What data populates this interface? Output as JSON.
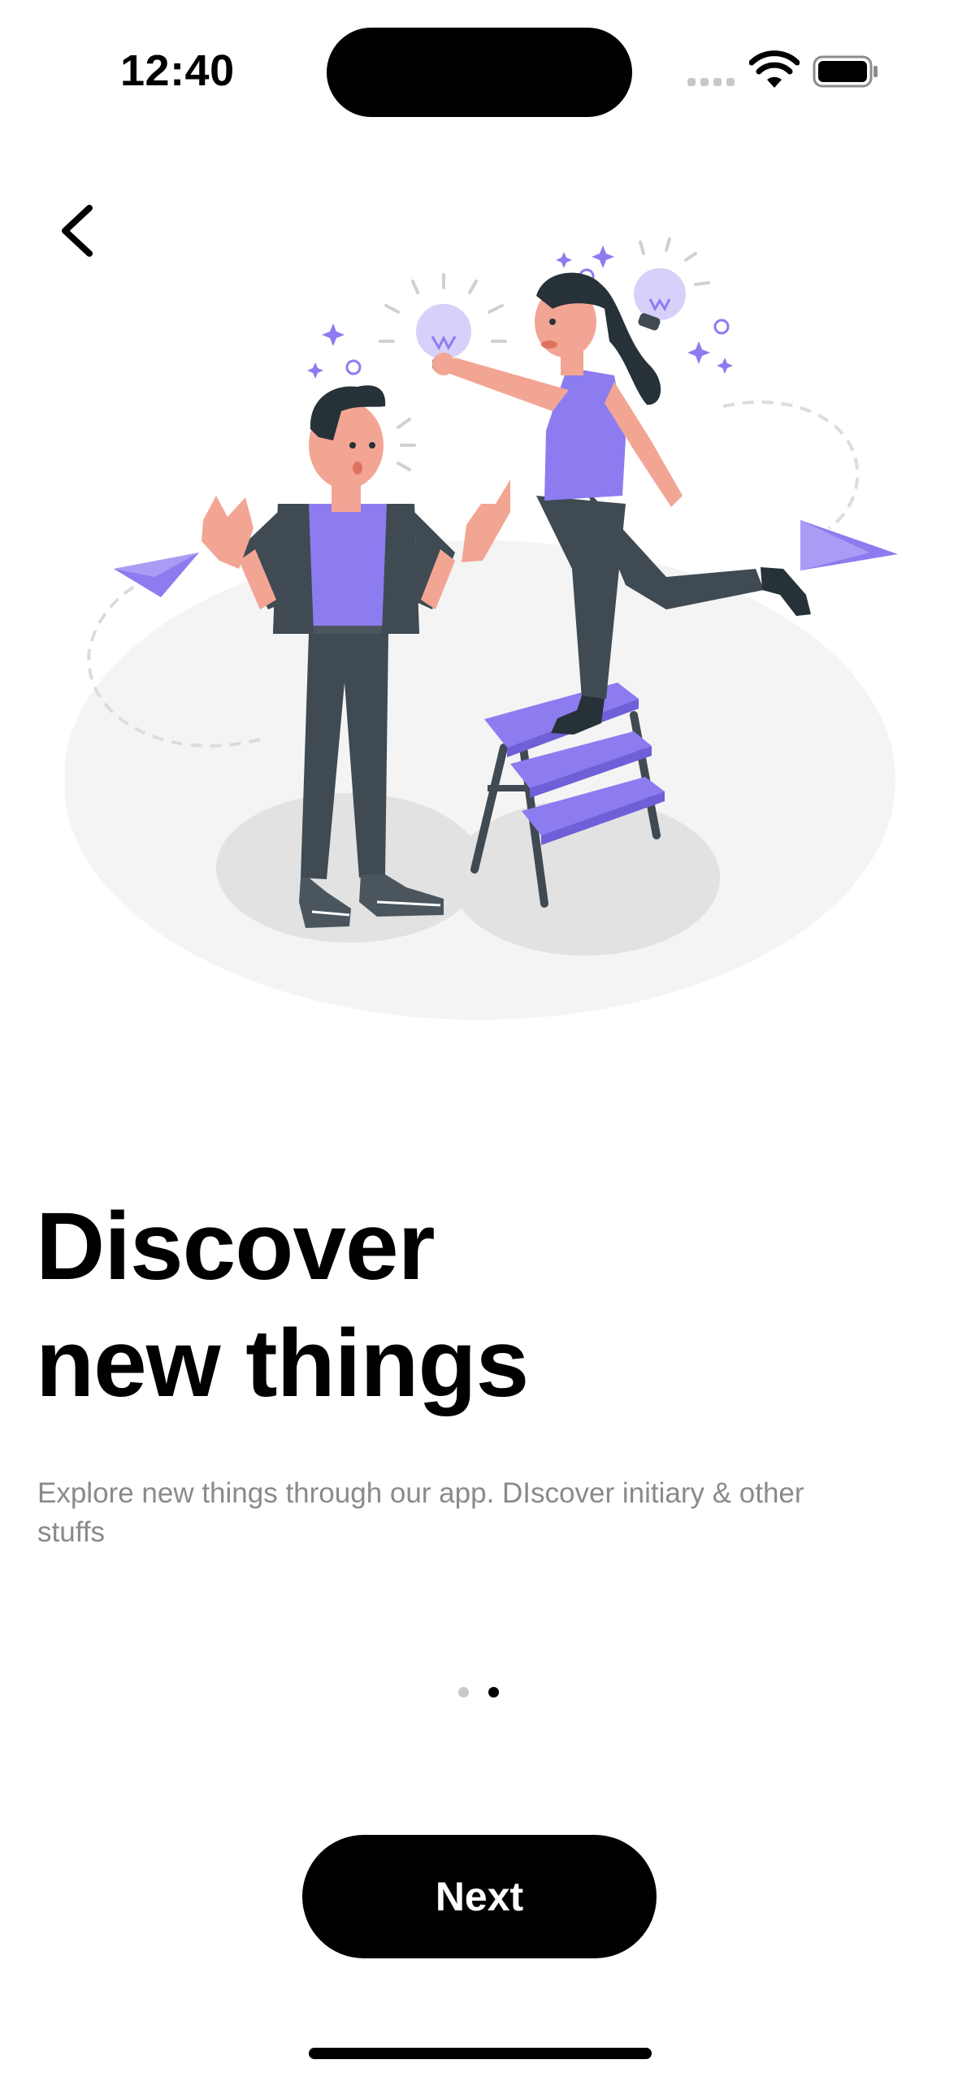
{
  "status_bar": {
    "time": "12:40"
  },
  "onboarding": {
    "headline_line1": "Discover",
    "headline_line2": "new things",
    "description": "Explore new things through our app. DIscover initiary & other stuffs",
    "pages_total": 2,
    "current_page": 2,
    "next_label": "Next"
  },
  "icons": {
    "back": "chevron-left-icon",
    "wifi": "wifi-icon",
    "battery": "battery-icon",
    "signal": "cellular-signal-icon"
  },
  "colors": {
    "accent": "#8c7cf0",
    "accent_light": "#d6d0fb",
    "dark_clothing": "#3f4a52",
    "skin": "#f3a594",
    "ground": "#f4f4f4",
    "ground_shadow": "#e2e2e2",
    "description_text": "#8a8a8a"
  }
}
